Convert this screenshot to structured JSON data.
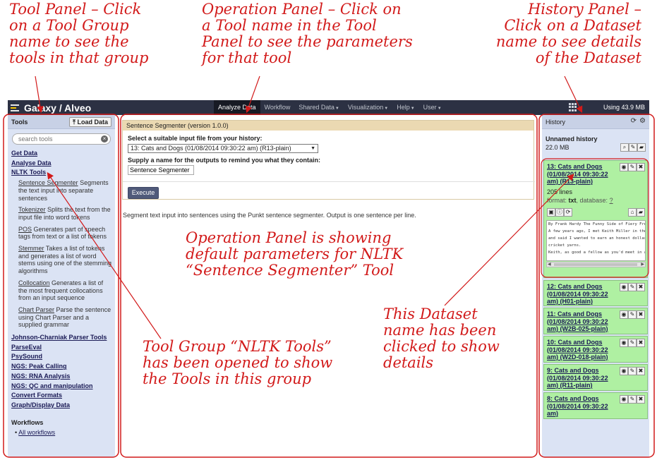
{
  "annotations": {
    "tool_panel": [
      "Tool Panel – Click",
      "on a Tool Group",
      "name to see the",
      "tools in that group"
    ],
    "operation_panel": [
      "Operation Panel – Click on",
      "a Tool name in the Tool",
      "Panel to see the parameters",
      "for that tool"
    ],
    "history_panel": [
      "History Panel –",
      "Click on a Dataset",
      "name to see details",
      "of the Dataset"
    ],
    "operation_showing": [
      "Operation Panel is showing",
      "default parameters for NLTK",
      "“Sentence Segmenter” Tool"
    ],
    "dataset_clicked": [
      "This Dataset",
      "name has been",
      "clicked to show",
      "details"
    ],
    "tool_group_opened": [
      "Tool Group “NLTK Tools”",
      "has been opened to show",
      "the Tools in this group"
    ]
  },
  "masthead": {
    "brand": "Galaxy / Alveo",
    "nav": [
      {
        "label": "Analyze Data",
        "active": true,
        "dropdown": false
      },
      {
        "label": "Workflow",
        "active": false,
        "dropdown": false
      },
      {
        "label": "Shared Data",
        "active": false,
        "dropdown": true
      },
      {
        "label": "Visualization",
        "active": false,
        "dropdown": true
      },
      {
        "label": "Help",
        "active": false,
        "dropdown": true
      },
      {
        "label": "User",
        "active": false,
        "dropdown": true
      }
    ],
    "quota": "Using 43.9 MB"
  },
  "tool_panel": {
    "title": "Tools",
    "load_data": "Load Data",
    "search_placeholder": "search tools",
    "groups_top": [
      "Get Data",
      "Analyse Data",
      "NLTK Tools"
    ],
    "nltk_tools": [
      {
        "name": "Sentence Segmenter",
        "desc": " Segments the text input into separate sentences"
      },
      {
        "name": "Tokenizer",
        "desc": " Splits the text from the input file into word tokens"
      },
      {
        "name": "POS",
        "desc": " Generates part of speech tags from text or a list of tokens"
      },
      {
        "name": "Stemmer",
        "desc": " Takes a list of tokens and generates a list of word stems using one of the stemming algorithms"
      },
      {
        "name": "Collocation",
        "desc": " Generates a list of the most frequent collocations from an input sequence"
      },
      {
        "name": "Chart Parser",
        "desc": " Parse the sentence using Chart Parser and a supplied grammar"
      }
    ],
    "groups_bottom": [
      "Johnson-Charniak Parser Tools",
      "ParseEval",
      "PsySound",
      "NGS: Peak Calling",
      "NGS: RNA Analysis",
      "NGS: QC and manipulation",
      "Convert Formats",
      "Graph/Display Data"
    ],
    "workflows_title": "Workflows",
    "all_workflows": "All workflows"
  },
  "operation": {
    "header": "Sentence Segmenter (version 1.0.0)",
    "input_label": "Select a suitable input file from your history:",
    "input_value": "13: Cats and Dogs (01/08/2014 09:30:22 am) (R13-plain)",
    "name_label": "Supply a name for the outputs to remind you what they contain:",
    "name_value": "Sentence Segmenter",
    "execute": "Execute",
    "help": "Segment text input into sentences using the Punkt sentence segmenter. Output is one sentence per line."
  },
  "history": {
    "title": "History",
    "name": "Unnamed history",
    "size": "22.0 MB",
    "expanded": {
      "title": "13: Cats and Dogs (01/08/2014 09:30:22 am) (R13-plain)",
      "lines": "205 lines",
      "format_label": "format: ",
      "format": "txt",
      "database_label": ", database: ",
      "database": "?",
      "peek": [
        "By Frank Hardy  The Funny Side of Fiery Fred",
        "A few years ago, I met Keith Miller in the St",
        "and said I wanted to earn an honest dollar cr",
        "cricket yarns.",
        "Keith, as good a fellow as you'd meet in a da"
      ]
    },
    "datasets": [
      "12: Cats and Dogs (01/08/2014 09:30:22 am) (H01-plain)",
      "11: Cats and Dogs (01/08/2014 09:30:22 am) (W2B-025-plain)",
      "10: Cats and Dogs (01/08/2014 09:30:22 am) (W2D-018-plain)",
      "9: Cats and Dogs (01/08/2014 09:30:22 am) (R11-plain)",
      "8: Cats and Dogs (01/08/2014 09:30:22 am)"
    ]
  }
}
